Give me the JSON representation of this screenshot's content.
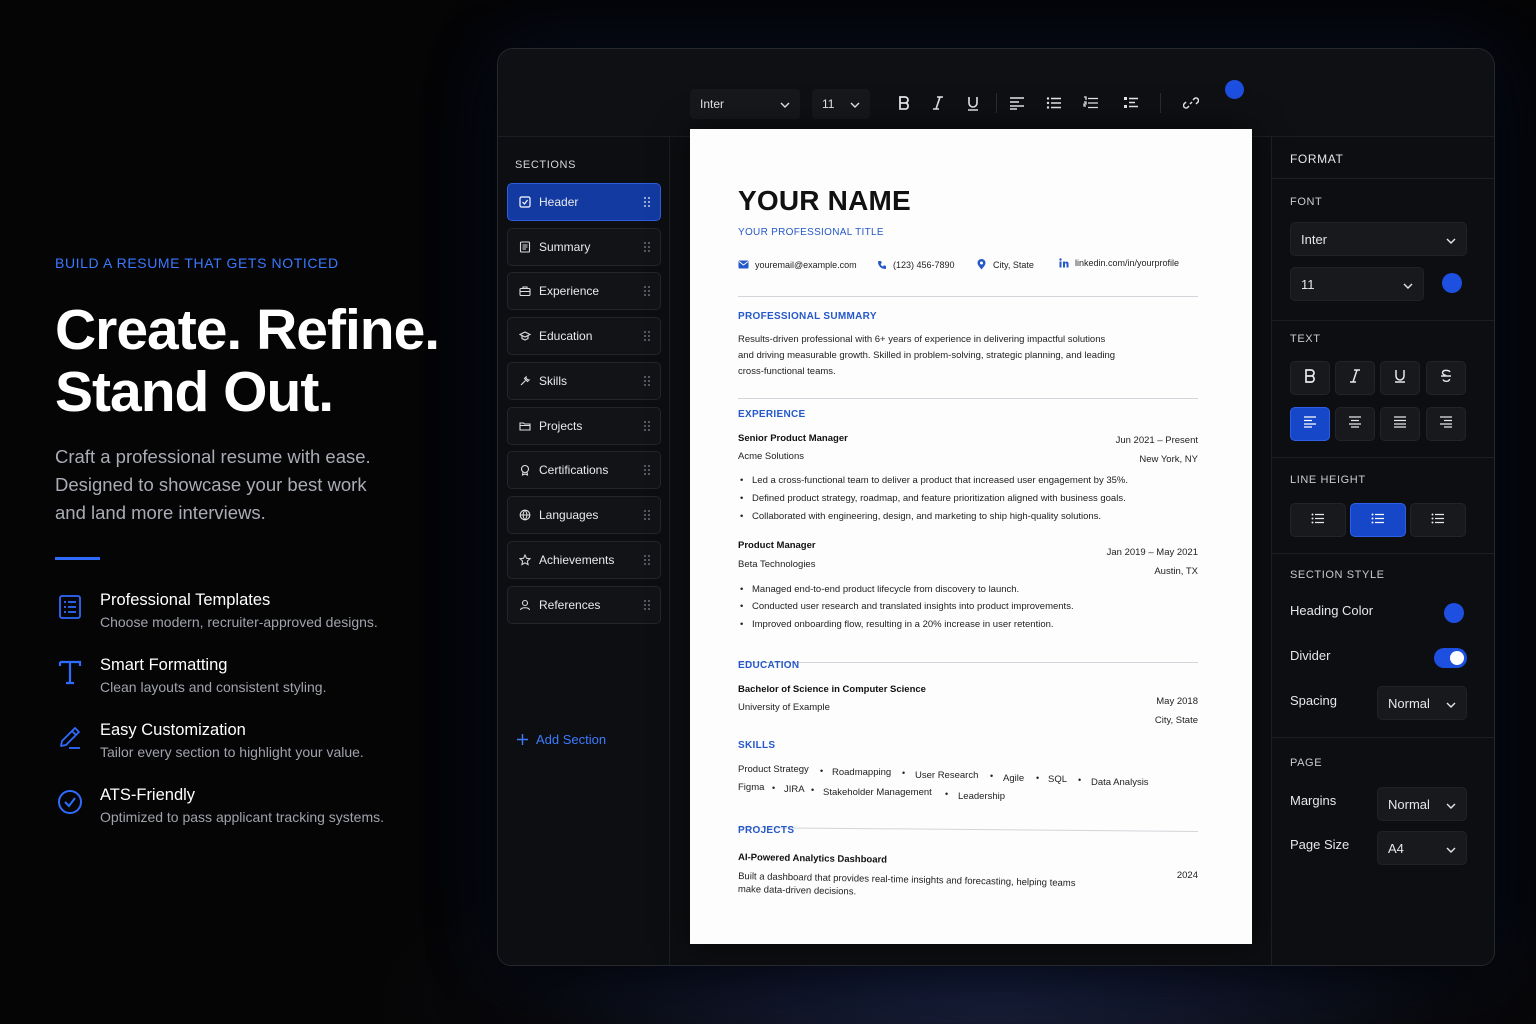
{
  "hero": {
    "eyebrow": "BUILD A RESUME THAT GETS NOTICED",
    "headline_line1": "Create. Refine.",
    "headline_line2": "Stand Out.",
    "subtitle": "Craft a professional resume with ease. Designed to showcase your best work and land more interviews.",
    "features": [
      {
        "icon": "template-list-icon",
        "title": "Professional Templates",
        "desc": "Choose modern, recruiter-approved designs."
      },
      {
        "icon": "text-t-icon",
        "title": "Smart Formatting",
        "desc": "Clean layouts and consistent styling."
      },
      {
        "icon": "pencil-icon",
        "title": "Easy Customization",
        "desc": "Tailor every section to highlight your value."
      },
      {
        "icon": "check-circle-icon",
        "title": "ATS-Friendly",
        "desc": "Optimized to pass applicant tracking systems."
      }
    ]
  },
  "toolbar": {
    "font": "Inter",
    "size": "11",
    "buttons": [
      "bold-icon",
      "italic-icon",
      "underline-icon",
      "align-left-icon",
      "bullet-list-icon",
      "numbered-list-icon",
      "checklist-icon",
      "link-icon"
    ],
    "color": "#1d4fe0"
  },
  "sidebar": {
    "title": "SECTIONS",
    "items": [
      {
        "label": "Header",
        "icon": "checkbox-icon",
        "active": true
      },
      {
        "label": "Summary",
        "icon": "document-icon"
      },
      {
        "label": "Experience",
        "icon": "briefcase-icon"
      },
      {
        "label": "Education",
        "icon": "graduation-cap-icon"
      },
      {
        "label": "Skills",
        "icon": "wrench-icon"
      },
      {
        "label": "Projects",
        "icon": "folder-icon"
      },
      {
        "label": "Certifications",
        "icon": "badge-icon"
      },
      {
        "label": "Languages",
        "icon": "globe-icon"
      },
      {
        "label": "Achievements",
        "icon": "star-icon"
      },
      {
        "label": "References",
        "icon": "person-icon"
      }
    ],
    "add_label": "Add Section"
  },
  "resume": {
    "name": "YOUR NAME",
    "title": "YOUR PROFESSIONAL TITLE",
    "email": "youremail@example.com",
    "phone": "(123) 456-7890",
    "location": "City, State",
    "linkedin": "linkedin.com/in/yourprofile",
    "summary_heading": "PROFESSIONAL SUMMARY",
    "summary_lines": [
      "Results-driven professional with 6+ years of experience in delivering impactful solutions",
      "and driving measurable growth. Skilled in problem-solving, strategic planning, and leading",
      "cross-functional teams."
    ],
    "experience_heading": "EXPERIENCE",
    "jobs": [
      {
        "role": "Senior Product Manager",
        "company": "Acme Solutions",
        "dates": "Jun 2021 – Present",
        "place": "New York, NY",
        "bullets": [
          "Led a cross-functional team to deliver a product that increased user engagement by 35%.",
          "Defined product strategy, roadmap, and feature prioritization aligned with business goals.",
          "Collaborated with engineering, design, and marketing to ship high-quality solutions."
        ]
      },
      {
        "role": "Product Manager",
        "company": "Beta Technologies",
        "dates": "Jan 2019 – May 2021",
        "place": "Austin, TX",
        "bullets": [
          "Managed end-to-end product lifecycle from discovery to launch.",
          "Conducted user research and translated insights into product improvements.",
          "Improved onboarding flow, resulting in a 20% increase in user retention."
        ]
      }
    ],
    "education_heading": "EDUCATION",
    "degree": "Bachelor of Science in Computer Science",
    "school": "University of Example",
    "edu_date": "May 2018",
    "edu_place": "City, State",
    "skills_heading": "SKILLS",
    "skills_row1": [
      "Product Strategy",
      "Roadmapping",
      "User Research",
      "Agile",
      "SQL",
      "Data Analysis"
    ],
    "skills_row2": [
      "Figma",
      "JIRA",
      "Stakeholder Management",
      "Leadership"
    ],
    "projects_heading": "PROJECTS",
    "project_name": "AI-Powered Analytics Dashboard",
    "project_year": "2024",
    "project_line1": "Built a dashboard that provides real-time insights and forecasting, helping teams",
    "project_line2": "make data-driven decisions."
  },
  "format": {
    "title": "FORMAT",
    "font_label": "FONT",
    "font": "Inter",
    "size": "11",
    "text_label": "TEXT",
    "line_height_label": "LINE HEIGHT",
    "section_style_label": "SECTION STYLE",
    "heading_color_label": "Heading Color",
    "divider_label": "Divider",
    "divider_on": true,
    "spacing_label": "Spacing",
    "spacing": "Normal",
    "page_label": "PAGE",
    "margins_label": "Margins",
    "margins": "Normal",
    "page_size_label": "Page Size",
    "page_size": "A4",
    "accent": "#1d4fe0"
  }
}
